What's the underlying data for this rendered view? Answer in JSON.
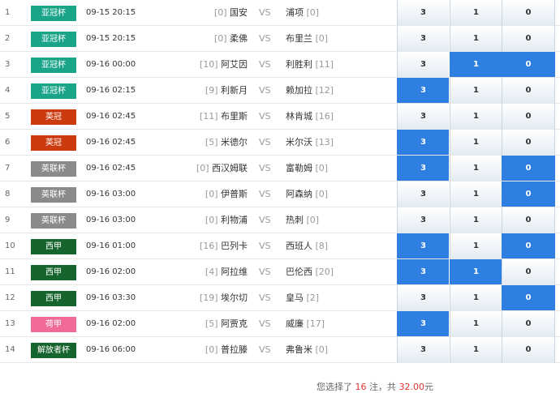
{
  "rows": [
    {
      "no": "1",
      "league": "亚冠杯",
      "color": "#1aa589",
      "time": "09-15 20:15",
      "home_rank": "[0]",
      "home": "国安",
      "vs": "VS",
      "away": "浦项",
      "away_rank": "[0]",
      "odds": [
        "3",
        "1",
        "0"
      ],
      "selected": [
        false,
        false,
        false
      ]
    },
    {
      "no": "2",
      "league": "亚冠杯",
      "color": "#1aa589",
      "time": "09-15 20:15",
      "home_rank": "[0]",
      "home": "柔佛",
      "vs": "VS",
      "away": "布里兰",
      "away_rank": "[0]",
      "odds": [
        "3",
        "1",
        "0"
      ],
      "selected": [
        false,
        false,
        false
      ]
    },
    {
      "no": "3",
      "league": "亚冠杯",
      "color": "#1aa589",
      "time": "09-16 00:00",
      "home_rank": "[10]",
      "home": "阿艾因",
      "vs": "VS",
      "away": "利胜利",
      "away_rank": "[11]",
      "odds": [
        "3",
        "1",
        "0"
      ],
      "selected": [
        false,
        true,
        true
      ]
    },
    {
      "no": "4",
      "league": "亚冠杯",
      "color": "#1aa589",
      "time": "09-16 02:15",
      "home_rank": "[9]",
      "home": "利新月",
      "vs": "VS",
      "away": "赖加拉",
      "away_rank": "[12]",
      "odds": [
        "3",
        "1",
        "0"
      ],
      "selected": [
        true,
        false,
        false
      ]
    },
    {
      "no": "5",
      "league": "英冠",
      "color": "#cc3b10",
      "time": "09-16 02:45",
      "home_rank": "[11]",
      "home": "布里斯",
      "vs": "VS",
      "away": "林肯城",
      "away_rank": "[16]",
      "odds": [
        "3",
        "1",
        "0"
      ],
      "selected": [
        false,
        false,
        false
      ]
    },
    {
      "no": "6",
      "league": "英冠",
      "color": "#cc3b10",
      "time": "09-16 02:45",
      "home_rank": "[5]",
      "home": "米德尔",
      "vs": "VS",
      "away": "米尔沃",
      "away_rank": "[13]",
      "odds": [
        "3",
        "1",
        "0"
      ],
      "selected": [
        true,
        false,
        false
      ]
    },
    {
      "no": "7",
      "league": "英联杯",
      "color": "#8a8a8a",
      "time": "09-16 02:45",
      "home_rank": "[0]",
      "home": "西汉姆联",
      "vs": "VS",
      "away": "富勒姆",
      "away_rank": "[0]",
      "odds": [
        "3",
        "1",
        "0"
      ],
      "selected": [
        true,
        false,
        true
      ]
    },
    {
      "no": "8",
      "league": "英联杯",
      "color": "#8a8a8a",
      "time": "09-16 03:00",
      "home_rank": "[0]",
      "home": "伊普斯",
      "vs": "VS",
      "away": "阿森纳",
      "away_rank": "[0]",
      "odds": [
        "3",
        "1",
        "0"
      ],
      "selected": [
        false,
        false,
        true
      ]
    },
    {
      "no": "9",
      "league": "英联杯",
      "color": "#8a8a8a",
      "time": "09-16 03:00",
      "home_rank": "[0]",
      "home": "利物浦",
      "vs": "VS",
      "away": "热刺",
      "away_rank": "[0]",
      "odds": [
        "3",
        "1",
        "0"
      ],
      "selected": [
        false,
        false,
        false
      ]
    },
    {
      "no": "10",
      "league": "西甲",
      "color": "#16642e",
      "time": "09-16 01:00",
      "home_rank": "[16]",
      "home": "巴列卡",
      "vs": "VS",
      "away": "西班人",
      "away_rank": "[8]",
      "odds": [
        "3",
        "1",
        "0"
      ],
      "selected": [
        true,
        false,
        true
      ]
    },
    {
      "no": "11",
      "league": "西甲",
      "color": "#16642e",
      "time": "09-16 02:00",
      "home_rank": "[4]",
      "home": "阿拉维",
      "vs": "VS",
      "away": "巴伦西",
      "away_rank": "[20]",
      "odds": [
        "3",
        "1",
        "0"
      ],
      "selected": [
        true,
        true,
        false
      ]
    },
    {
      "no": "12",
      "league": "西甲",
      "color": "#16642e",
      "time": "09-16 03:30",
      "home_rank": "[19]",
      "home": "埃尔切",
      "vs": "VS",
      "away": "皇马",
      "away_rank": "[2]",
      "odds": [
        "3",
        "1",
        "0"
      ],
      "selected": [
        false,
        false,
        true
      ]
    },
    {
      "no": "13",
      "league": "荷甲",
      "color": "#f06a9a",
      "time": "09-16 02:00",
      "home_rank": "[5]",
      "home": "阿贾克",
      "vs": "VS",
      "away": "威廉",
      "away_rank": "[17]",
      "odds": [
        "3",
        "1",
        "0"
      ],
      "selected": [
        true,
        false,
        false
      ]
    },
    {
      "no": "14",
      "league": "解放者杯",
      "color": "#16642e",
      "time": "09-16 06:00",
      "home_rank": "[0]",
      "home": "普拉滕",
      "vs": "VS",
      "away": "弗鲁米",
      "away_rank": "[0]",
      "odds": [
        "3",
        "1",
        "0"
      ],
      "selected": [
        false,
        false,
        false
      ]
    }
  ],
  "footer": {
    "prefix": "您选择了 ",
    "count": "16",
    "mid": " 注，共 ",
    "amount": "32.00",
    "suffix": "元"
  }
}
